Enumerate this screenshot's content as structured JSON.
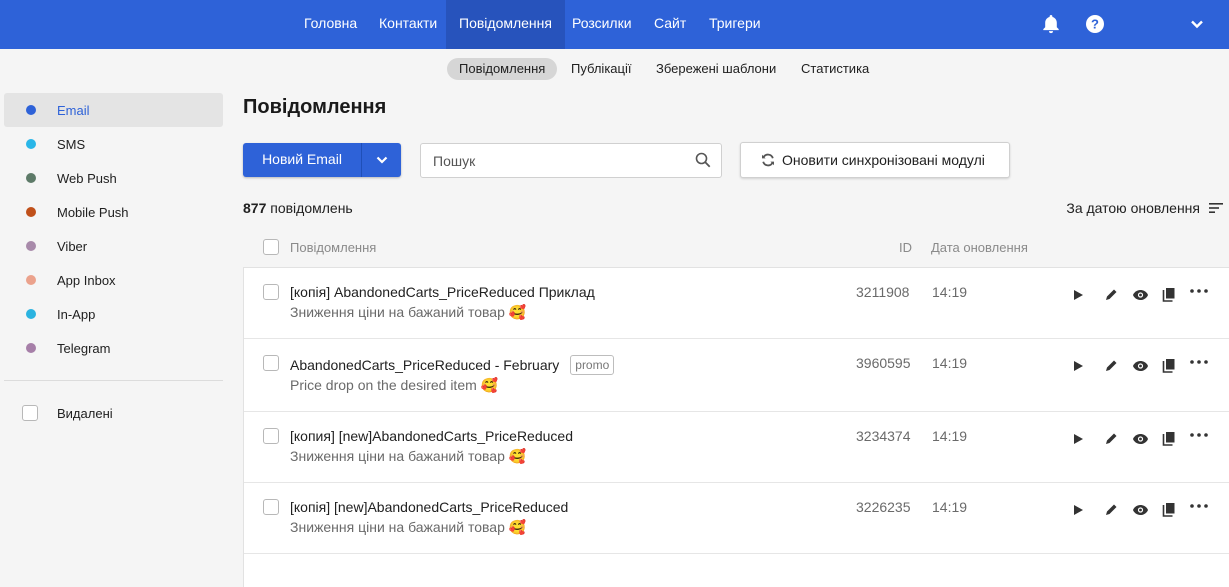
{
  "topnav": {
    "items": [
      {
        "label": "Головна"
      },
      {
        "label": "Контакти"
      },
      {
        "label": "Повідомлення",
        "active": true
      },
      {
        "label": "Розсилки"
      },
      {
        "label": "Сайт"
      },
      {
        "label": "Тригери"
      }
    ],
    "accent_color": "#2e62d8"
  },
  "subnav": {
    "items": [
      {
        "label": "Повідомлення",
        "active": true
      },
      {
        "label": "Публікації"
      },
      {
        "label": "Збережені шаблони"
      },
      {
        "label": "Статистика"
      }
    ]
  },
  "sidebar": {
    "channels": [
      {
        "label": "Email",
        "color": "#2e62d8",
        "active": true
      },
      {
        "label": "SMS",
        "color": "#29b6e8"
      },
      {
        "label": "Web Push",
        "color": "#5d7a68"
      },
      {
        "label": "Mobile Push",
        "color": "#c0501a"
      },
      {
        "label": "Viber",
        "color": "#a88aaa"
      },
      {
        "label": "App Inbox",
        "color": "#eba28c"
      },
      {
        "label": "In-App",
        "color": "#2bb3e0"
      },
      {
        "label": "Telegram",
        "color": "#a67fa8"
      }
    ],
    "deleted_label": "Видалені"
  },
  "main": {
    "title": "Повідомлення",
    "new_button_label": "Новий Email",
    "search_placeholder": "Пошук",
    "sync_button_label": "Оновити синхронізовані модулі",
    "count_number": "877",
    "count_label": "повідомлень",
    "sort_label": "За датою оновлення",
    "columns": {
      "message": "Повідомлення",
      "id": "ID",
      "date": "Дата оновлення"
    },
    "rows": [
      {
        "title": "[копія] AbandonedCarts_PriceReduced Приклад",
        "tag": "",
        "subtitle": "Зниження ціни на бажаний товар 🥰",
        "id": "3211908",
        "date": "14:19"
      },
      {
        "title": "AbandonedCarts_PriceReduced - February",
        "tag": "promo",
        "subtitle": "Price drop on the desired item 🥰",
        "id": "3960595",
        "date": "14:19"
      },
      {
        "title": "[копия] [new]AbandonedCarts_PriceReduced",
        "tag": "",
        "subtitle": "Зниження ціни на бажаний товар 🥰",
        "id": "3234374",
        "date": "14:19"
      },
      {
        "title": "[копія] [new]AbandonedCarts_PriceReduced",
        "tag": "",
        "subtitle": "Зниження ціни на бажаний товар 🥰",
        "id": "3226235",
        "date": "14:19"
      }
    ]
  }
}
